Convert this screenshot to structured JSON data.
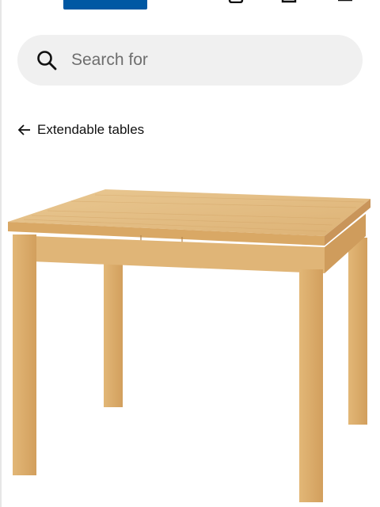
{
  "header": {
    "logo_icon": "brand-logo",
    "icons": [
      "user-icon",
      "shopping-bag-icon",
      "menu-icon"
    ],
    "brand_colors": {
      "blue": "#0058a3",
      "yellow": "#ffdb00"
    }
  },
  "search": {
    "placeholder": "Search for",
    "value": "",
    "icon": "search-icon"
  },
  "breadcrumb": {
    "icon": "back-arrow-icon",
    "label": "Extendable tables"
  },
  "product": {
    "image_icon": "extendable-table-image",
    "wood_colors": {
      "top": "#e3bd82",
      "edge": "#d9a865",
      "leg": "#dcae6c"
    }
  }
}
